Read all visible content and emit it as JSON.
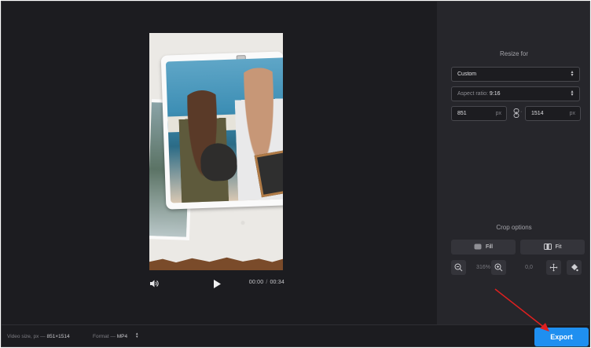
{
  "player": {
    "current_time": "00:00",
    "time_separator": "/",
    "duration": "00:34"
  },
  "resize": {
    "heading": "Resize for",
    "preset": "Custom",
    "aspect_label": "Aspect ratio:",
    "aspect_value": "9:16",
    "width": "851",
    "height": "1514",
    "unit": "px"
  },
  "crop": {
    "heading": "Crop options",
    "fill_label": "Fill",
    "fit_label": "Fit",
    "zoom": "316%",
    "position": "0,0"
  },
  "footer": {
    "video_size_label": "Video size, px —",
    "video_size_value": "851×1514",
    "format_label": "Format —",
    "format_value": "MP4"
  },
  "export_label": "Export",
  "colors": {
    "accent": "#1f8ff0",
    "annotation_arrow": "#e02020",
    "panel_bg": "#26262b",
    "app_bg": "#1c1c20"
  },
  "icons": [
    "back-icon",
    "volume-icon",
    "play-icon",
    "caret-icon",
    "link-icon",
    "fill-icon",
    "fit-icon",
    "zoom-out-icon",
    "zoom-in-icon",
    "move-icon",
    "paint-bucket-icon"
  ]
}
